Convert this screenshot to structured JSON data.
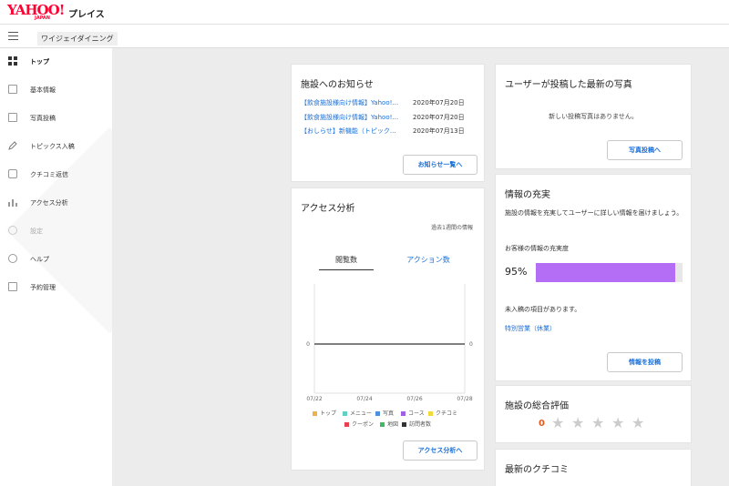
{
  "header": {
    "logo": "YAHOO!",
    "logo_sub": "JAPAN",
    "brand": "プレイス"
  },
  "subbar": {
    "store_name": "ワイジェイダイニング"
  },
  "sidebar": {
    "items": [
      {
        "label": "トップ",
        "icon": "dashboard-icon"
      },
      {
        "label": "基本情報",
        "icon": "document-icon"
      },
      {
        "label": "写真投稿",
        "icon": "photo-icon"
      },
      {
        "label": "トピックス入稿",
        "icon": "pencil-icon"
      },
      {
        "label": "クチコミ返信",
        "icon": "chat-icon"
      },
      {
        "label": "アクセス分析",
        "icon": "bar-chart-icon"
      },
      {
        "label": "設定",
        "icon": "gear-icon"
      },
      {
        "label": "ヘルプ",
        "icon": "help-icon"
      },
      {
        "label": "予約管理",
        "icon": "calendar-icon"
      }
    ]
  },
  "news": {
    "title": "施設へのお知らせ",
    "items": [
      {
        "text": "【飲食施設様向け情報】Yahoo!...",
        "date": "2020年07月20日"
      },
      {
        "text": "【飲食施設様向け情報】Yahoo!...",
        "date": "2020年07月20日"
      },
      {
        "text": "【おしらせ】新機能（トピック...",
        "date": "2020年07月13日"
      }
    ],
    "button": "お知らせ一覧へ"
  },
  "analytics": {
    "title": "アクセス分析",
    "note": "過去1週間の情報",
    "tabs": [
      "閲覧数",
      "アクション数"
    ],
    "button": "アクセス分析へ",
    "legend": [
      {
        "label": "トップ",
        "color": "#f0b04a"
      },
      {
        "label": "メニュー",
        "color": "#5fd0c3"
      },
      {
        "label": "写真",
        "color": "#4a8fe0"
      },
      {
        "label": "コース",
        "color": "#a35ee6"
      },
      {
        "label": "クチコミ",
        "color": "#f2da3a"
      },
      {
        "label": "クーポン",
        "color": "#e8404f"
      },
      {
        "label": "地図",
        "color": "#3fb868"
      },
      {
        "label": "訪問者数",
        "color": "#333333"
      }
    ]
  },
  "chart_data": {
    "type": "line",
    "x": [
      "07/22",
      "07/24",
      "07/26",
      "07/28"
    ],
    "series": [
      {
        "name": "訪問者数",
        "values": [
          0,
          0,
          0,
          0
        ]
      }
    ],
    "yticks_left": [
      "0"
    ],
    "yticks_right": [
      "0"
    ],
    "grid": false,
    "legend_position": "bottom"
  },
  "photos": {
    "title": "ユーザーが投稿した最新の写真",
    "empty": "新しい投稿写真はありません。",
    "button": "写真投稿へ"
  },
  "info": {
    "title": "情報の充実",
    "desc": "施設の情報を充実してユーザーに詳しい情報を届けましょう。",
    "rate_label": "お客様の情報の充実度",
    "rate_text": "95%",
    "rate_value": 95,
    "bar_color": "#b36ef5",
    "missing": "未入稿の項目があります。",
    "missing_link": "特別営業（休業）",
    "button": "情報を投稿"
  },
  "rating": {
    "title": "施設の総合評価",
    "score": "0",
    "stars": 5
  },
  "reviews": {
    "title": "最新のクチコミ"
  }
}
